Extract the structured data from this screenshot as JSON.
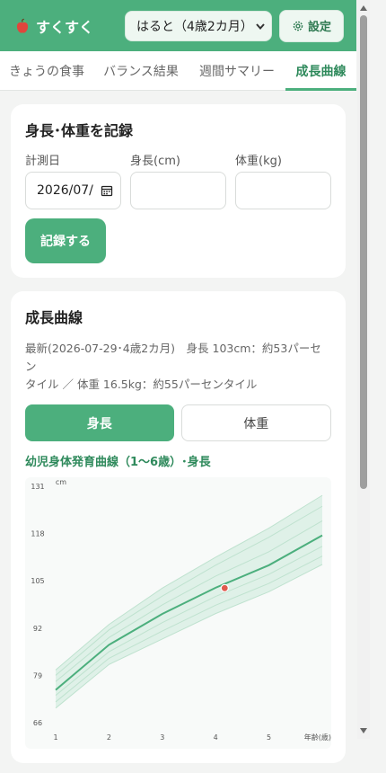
{
  "header": {
    "app_name": "すくすく",
    "child_select_value": "はると（4歳2カ月）",
    "settings_label": "設定"
  },
  "tabs": [
    {
      "label": "きょうの食事"
    },
    {
      "label": "バランス結果"
    },
    {
      "label": "週間サマリー"
    },
    {
      "label": "成長曲線",
      "active": true
    }
  ],
  "record_form": {
    "title": "身長･体重を記録",
    "date_label": "計測日",
    "date_value": "2026/07/",
    "height_label": "身長(cm)",
    "weight_label": "体重(kg)",
    "submit_label": "記録する"
  },
  "growth": {
    "title": "成長曲線",
    "latest_line1": "最新(2026-07-29･4歳2カ月)　身長 103cm：約53パーセン",
    "latest_line2": "タイル ／ 体重 16.5kg：約55パーセンタイル",
    "toggle_height": "身長",
    "toggle_weight": "体重",
    "chart_heading": "幼児身体発育曲線（1〜6歳）･身長"
  },
  "colors": {
    "brand": "#4caf7d",
    "band": "#d8efe3",
    "line": "#4caf7d",
    "point": "#e05a4e"
  },
  "chart_data": {
    "type": "line",
    "title": "",
    "xlabel": "年齢(歳)",
    "ylabel": "cm",
    "xlim": [
      1,
      6
    ],
    "ylim": [
      66,
      131
    ],
    "xticks": [
      1,
      2,
      3,
      4,
      5
    ],
    "yticks": [
      66,
      79,
      92,
      105,
      118,
      131
    ],
    "x": [
      1,
      2,
      3,
      4,
      5,
      6
    ],
    "band_upper": [
      80.5,
      93,
      103,
      111.5,
      119.5,
      128.5
    ],
    "band_lower": [
      70,
      82,
      89,
      96,
      102,
      109.5
    ],
    "percentile_lines": [
      [
        79,
        91.5,
        100.8,
        109.3,
        117,
        125.5
      ],
      [
        77.3,
        89.4,
        98.4,
        106.3,
        113,
        121.5
      ],
      [
        73.5,
        85.5,
        93.5,
        100.7,
        106.8,
        114.5
      ],
      [
        71.7,
        83.7,
        91.2,
        98.3,
        104.3,
        111.8
      ]
    ],
    "series": [
      {
        "values": [
          75,
          87.4,
          95.9,
          103.1,
          109.3,
          117.5
        ]
      }
    ],
    "point": {
      "x": 4.17,
      "y": 103
    }
  }
}
